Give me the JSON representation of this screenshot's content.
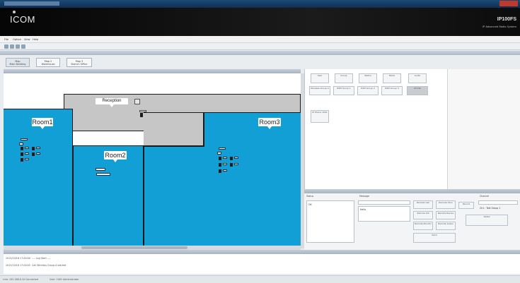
{
  "window": {
    "title": "IP Advanced Radio System"
  },
  "banner": {
    "brand": "ICOM",
    "product": "IP100FS",
    "product_sub": "IP Advanced Radio System"
  },
  "menu": [
    "File",
    "Option",
    "View",
    "Help"
  ],
  "tabs": [
    {
      "line1": "Map",
      "line2": "Main Building"
    },
    {
      "line1": "Map 2",
      "line2": "Warehouse"
    },
    {
      "line1": "Map 3",
      "line2": "Branch Office"
    }
  ],
  "map": {
    "rooms": [
      {
        "label": "Room1",
        "color": "#129fd6"
      },
      {
        "label": "Room2",
        "color": "#129fd6"
      },
      {
        "label": "Room3",
        "color": "#129fd6"
      },
      {
        "label": "Reception",
        "color": "#c6c6c6"
      }
    ]
  },
  "contacts": {
    "header_buttons": [
      "User",
      "Group",
      "Status",
      "Mode",
      "Audio"
    ],
    "row_buttons": [
      "Wireless Group A",
      "RSM Group 1",
      "RSM Group 2",
      "RSM Group 3"
    ],
    "all_call": "All Call",
    "single": "IP Phone 1001"
  },
  "controls": {
    "status_label": "Status",
    "status_value": "OK",
    "message_label": "Message",
    "message_text": "Hello",
    "buttons": [
      "Remote Call",
      "Remote Stun",
      "Remote Kill",
      "Remote Revive",
      "Remote Monitor",
      "Remote Listen",
      "Record",
      "Detail",
      "Send"
    ],
    "channel_label": "Channel",
    "channel_value": "Ch1 : Talk Group 1"
  },
  "log": [
    {
      "time": "2013/10/16 17:00:00",
      "text": "---- Log Start ----"
    },
    {
      "time": "2013/10/16 17:00:05",
      "text": "Call Wireless Group A started"
    }
  ],
  "status": {
    "left": "Line: 192.168.0.10 Connected",
    "right": "User: 1001 Administrator"
  },
  "colors": {
    "accent": "#129fd6",
    "banner": "#0a0a0a",
    "titlebar": "#163f6a"
  }
}
